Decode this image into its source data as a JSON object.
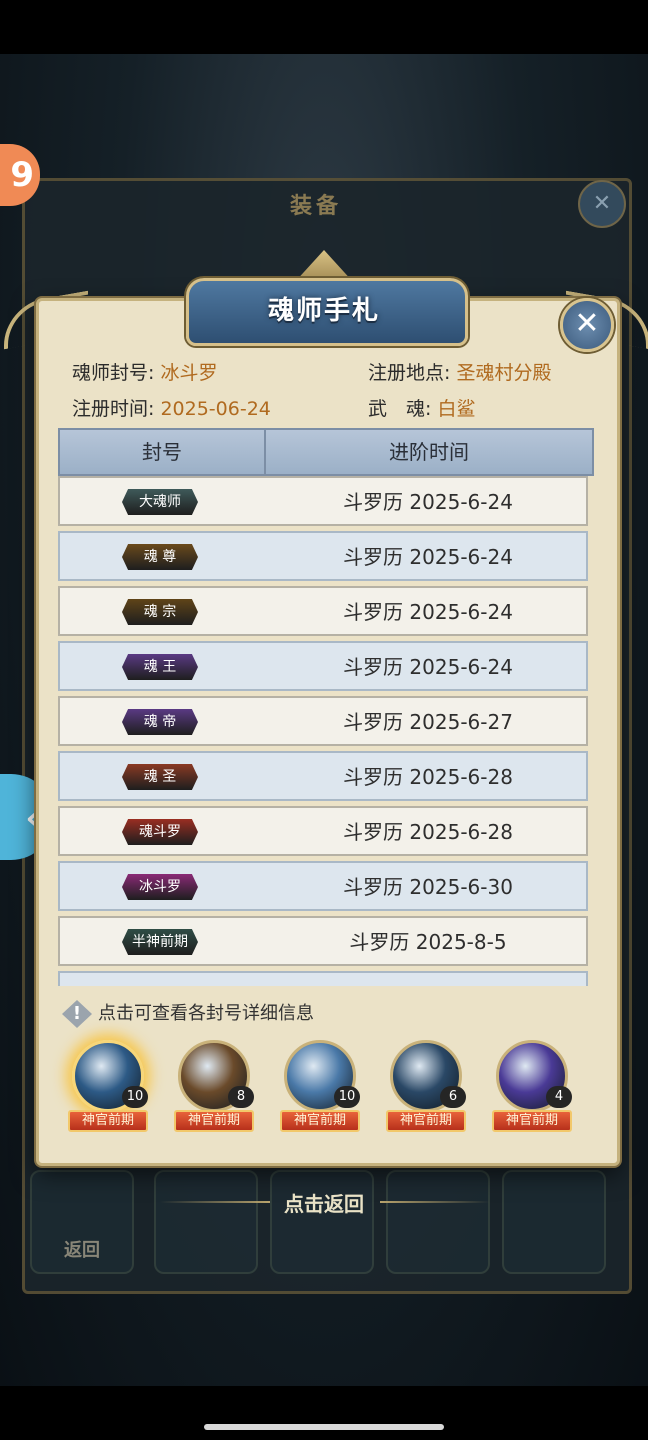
{
  "background": {
    "title": "装备",
    "back_label": "返回",
    "slot_labels": [
      "",
      "",
      "",
      "",
      ""
    ]
  },
  "modal": {
    "title": "魂师手札",
    "info": {
      "title_label": "魂师封号:",
      "title_value": "冰斗罗",
      "location_label": "注册地点:",
      "location_value": "圣魂村分殿",
      "time_label": "注册时间:",
      "time_value": "2025-06-24",
      "spirit_label": "武　魂:",
      "spirit_value": "白鲨"
    },
    "table": {
      "headers": [
        "封号",
        "进阶时间"
      ],
      "rows": [
        {
          "badge": "大魂师",
          "date": "斗罗历 2025-6-24",
          "color": "#3f5a5a"
        },
        {
          "badge": "魂 尊",
          "date": "斗罗历 2025-6-24",
          "color": "#6a4a1c"
        },
        {
          "badge": "魂 宗",
          "date": "斗罗历 2025-6-24",
          "color": "#5f4418"
        },
        {
          "badge": "魂 王",
          "date": "斗罗历 2025-6-24",
          "color": "#5a3a84"
        },
        {
          "badge": "魂 帝",
          "date": "斗罗历 2025-6-27",
          "color": "#5a3a84"
        },
        {
          "badge": "魂 圣",
          "date": "斗罗历 2025-6-28",
          "color": "#8a3a24"
        },
        {
          "badge": "魂斗罗",
          "date": "斗罗历 2025-6-28",
          "color": "#9a2e22"
        },
        {
          "badge": "冰斗罗",
          "date": "斗罗历 2025-6-30",
          "color": "#8a2a76"
        },
        {
          "badge": "半神前期",
          "date": "斗罗历 2025-8-5",
          "color": "#2f4d46"
        }
      ]
    },
    "hint": "点击可查看各封号详细信息",
    "avatars": [
      {
        "count": "10",
        "tag": "神官前期",
        "color": "#2d5a86"
      },
      {
        "count": "8",
        "tag": "神官前期",
        "color": "#6a4a2a"
      },
      {
        "count": "10",
        "tag": "神官前期",
        "color": "#4a79a8"
      },
      {
        "count": "6",
        "tag": "神官前期",
        "color": "#2a4866"
      },
      {
        "count": "4",
        "tag": "神官前期",
        "color": "#4a3a96"
      }
    ]
  },
  "return_label": "点击返回",
  "colors": {
    "accent_gold": "#c5b27e",
    "value_orange": "#b06a1f",
    "tag_red": "#d2462a"
  }
}
